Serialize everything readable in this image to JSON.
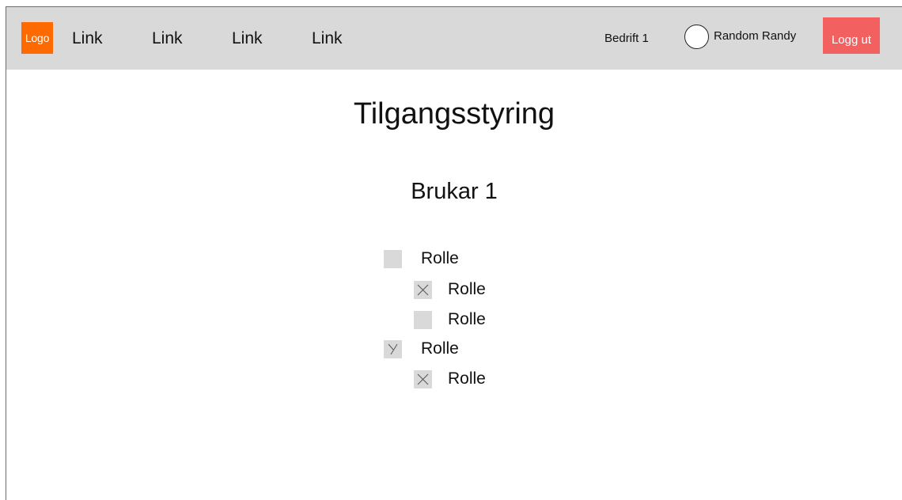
{
  "header": {
    "logo_text": "Logo",
    "nav_links": [
      "Link",
      "Link",
      "Link",
      "Link"
    ],
    "company": "Bedrift 1",
    "username": "Random Randy",
    "logout_label": "Logg ut",
    "colors": {
      "bar_bg": "#d9d9d9",
      "logo_bg": "#ff6a00",
      "logout_bg": "#f26060"
    }
  },
  "main": {
    "title": "Tilgangsstyring",
    "user_name": "Brukar 1",
    "roles": [
      {
        "label": "Rolle",
        "level": 0,
        "checked": false,
        "mark": "none"
      },
      {
        "label": "Rolle",
        "level": 1,
        "checked": true,
        "mark": "cross"
      },
      {
        "label": "Rolle",
        "level": 1,
        "checked": false,
        "mark": "none"
      },
      {
        "label": "Rolle",
        "level": 0,
        "checked": "partial",
        "mark": "partial-cross"
      },
      {
        "label": "Rolle",
        "level": 1,
        "checked": true,
        "mark": "cross"
      }
    ]
  }
}
